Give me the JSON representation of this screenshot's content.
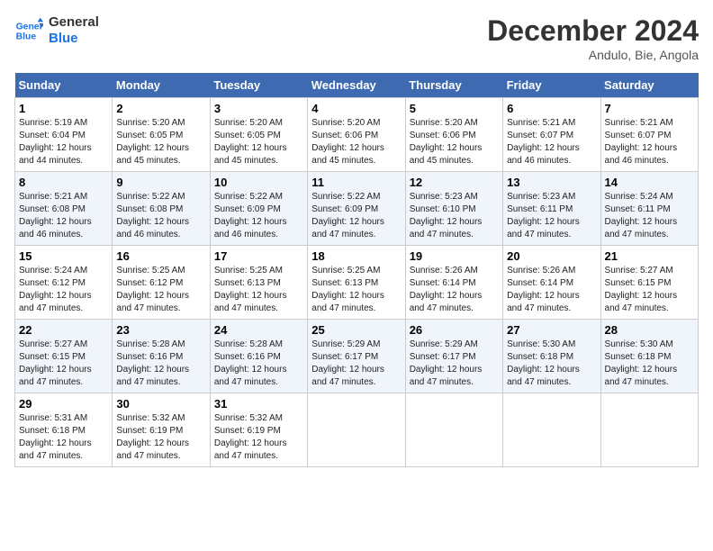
{
  "logo": {
    "line1": "General",
    "line2": "Blue"
  },
  "title": "December 2024",
  "subtitle": "Andulo, Bie, Angola",
  "days_header": [
    "Sunday",
    "Monday",
    "Tuesday",
    "Wednesday",
    "Thursday",
    "Friday",
    "Saturday"
  ],
  "weeks": [
    [
      {
        "day": "1",
        "sunrise": "5:19 AM",
        "sunset": "6:04 PM",
        "daylight": "12 hours and 44 minutes."
      },
      {
        "day": "2",
        "sunrise": "5:20 AM",
        "sunset": "6:05 PM",
        "daylight": "12 hours and 45 minutes."
      },
      {
        "day": "3",
        "sunrise": "5:20 AM",
        "sunset": "6:05 PM",
        "daylight": "12 hours and 45 minutes."
      },
      {
        "day": "4",
        "sunrise": "5:20 AM",
        "sunset": "6:06 PM",
        "daylight": "12 hours and 45 minutes."
      },
      {
        "day": "5",
        "sunrise": "5:20 AM",
        "sunset": "6:06 PM",
        "daylight": "12 hours and 45 minutes."
      },
      {
        "day": "6",
        "sunrise": "5:21 AM",
        "sunset": "6:07 PM",
        "daylight": "12 hours and 46 minutes."
      },
      {
        "day": "7",
        "sunrise": "5:21 AM",
        "sunset": "6:07 PM",
        "daylight": "12 hours and 46 minutes."
      }
    ],
    [
      {
        "day": "8",
        "sunrise": "5:21 AM",
        "sunset": "6:08 PM",
        "daylight": "12 hours and 46 minutes."
      },
      {
        "day": "9",
        "sunrise": "5:22 AM",
        "sunset": "6:08 PM",
        "daylight": "12 hours and 46 minutes."
      },
      {
        "day": "10",
        "sunrise": "5:22 AM",
        "sunset": "6:09 PM",
        "daylight": "12 hours and 46 minutes."
      },
      {
        "day": "11",
        "sunrise": "5:22 AM",
        "sunset": "6:09 PM",
        "daylight": "12 hours and 47 minutes."
      },
      {
        "day": "12",
        "sunrise": "5:23 AM",
        "sunset": "6:10 PM",
        "daylight": "12 hours and 47 minutes."
      },
      {
        "day": "13",
        "sunrise": "5:23 AM",
        "sunset": "6:11 PM",
        "daylight": "12 hours and 47 minutes."
      },
      {
        "day": "14",
        "sunrise": "5:24 AM",
        "sunset": "6:11 PM",
        "daylight": "12 hours and 47 minutes."
      }
    ],
    [
      {
        "day": "15",
        "sunrise": "5:24 AM",
        "sunset": "6:12 PM",
        "daylight": "12 hours and 47 minutes."
      },
      {
        "day": "16",
        "sunrise": "5:25 AM",
        "sunset": "6:12 PM",
        "daylight": "12 hours and 47 minutes."
      },
      {
        "day": "17",
        "sunrise": "5:25 AM",
        "sunset": "6:13 PM",
        "daylight": "12 hours and 47 minutes."
      },
      {
        "day": "18",
        "sunrise": "5:25 AM",
        "sunset": "6:13 PM",
        "daylight": "12 hours and 47 minutes."
      },
      {
        "day": "19",
        "sunrise": "5:26 AM",
        "sunset": "6:14 PM",
        "daylight": "12 hours and 47 minutes."
      },
      {
        "day": "20",
        "sunrise": "5:26 AM",
        "sunset": "6:14 PM",
        "daylight": "12 hours and 47 minutes."
      },
      {
        "day": "21",
        "sunrise": "5:27 AM",
        "sunset": "6:15 PM",
        "daylight": "12 hours and 47 minutes."
      }
    ],
    [
      {
        "day": "22",
        "sunrise": "5:27 AM",
        "sunset": "6:15 PM",
        "daylight": "12 hours and 47 minutes."
      },
      {
        "day": "23",
        "sunrise": "5:28 AM",
        "sunset": "6:16 PM",
        "daylight": "12 hours and 47 minutes."
      },
      {
        "day": "24",
        "sunrise": "5:28 AM",
        "sunset": "6:16 PM",
        "daylight": "12 hours and 47 minutes."
      },
      {
        "day": "25",
        "sunrise": "5:29 AM",
        "sunset": "6:17 PM",
        "daylight": "12 hours and 47 minutes."
      },
      {
        "day": "26",
        "sunrise": "5:29 AM",
        "sunset": "6:17 PM",
        "daylight": "12 hours and 47 minutes."
      },
      {
        "day": "27",
        "sunrise": "5:30 AM",
        "sunset": "6:18 PM",
        "daylight": "12 hours and 47 minutes."
      },
      {
        "day": "28",
        "sunrise": "5:30 AM",
        "sunset": "6:18 PM",
        "daylight": "12 hours and 47 minutes."
      }
    ],
    [
      {
        "day": "29",
        "sunrise": "5:31 AM",
        "sunset": "6:18 PM",
        "daylight": "12 hours and 47 minutes."
      },
      {
        "day": "30",
        "sunrise": "5:32 AM",
        "sunset": "6:19 PM",
        "daylight": "12 hours and 47 minutes."
      },
      {
        "day": "31",
        "sunrise": "5:32 AM",
        "sunset": "6:19 PM",
        "daylight": "12 hours and 47 minutes."
      },
      null,
      null,
      null,
      null
    ]
  ],
  "labels": {
    "sunrise": "Sunrise:",
    "sunset": "Sunset:",
    "daylight": "Daylight:"
  }
}
